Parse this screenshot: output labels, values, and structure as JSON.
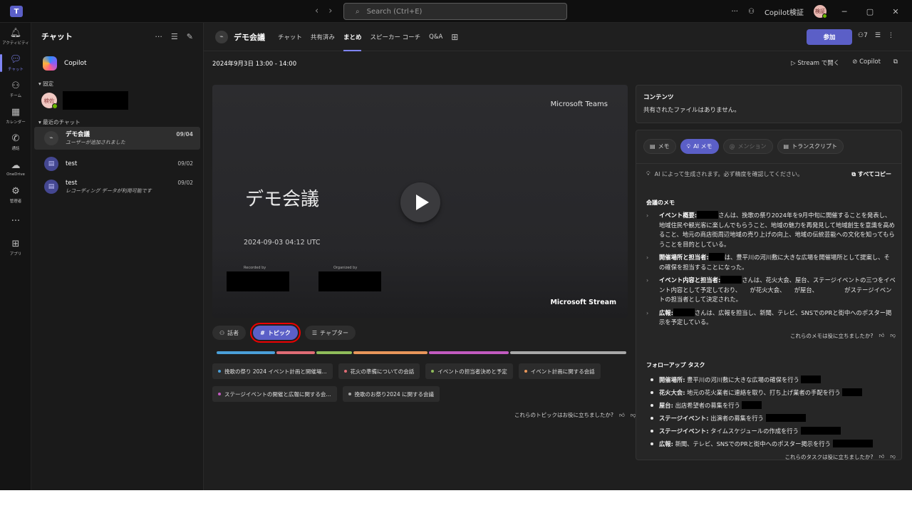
{
  "titlebar": {
    "search_placeholder": "Search (Ctrl+E)",
    "user_name": "Copilot検証",
    "user_initials": "検証"
  },
  "rail": [
    {
      "label": "アクティビティ",
      "icon": "bell-icon"
    },
    {
      "label": "チャット",
      "icon": "chat-icon"
    },
    {
      "label": "チーム",
      "icon": "teams-icon"
    },
    {
      "label": "カレンダー",
      "icon": "calendar-icon"
    },
    {
      "label": "通話",
      "icon": "phone-icon"
    },
    {
      "label": "OneDrive",
      "icon": "cloud-icon"
    },
    {
      "label": "管理者",
      "icon": "admin-icon"
    },
    {
      "label": "",
      "icon": "more-icon"
    },
    {
      "label": "アプリ",
      "icon": "apps-icon"
    }
  ],
  "chatlist": {
    "title": "チャット",
    "copilot": "Copilot",
    "pinned_label": "固定",
    "pinned_initials": "検佐",
    "recent_label": "最近のチャット",
    "chats": [
      {
        "name": "デモ会議",
        "sub": "ユーザーが追加されました",
        "date": "09/04"
      },
      {
        "name": "test",
        "sub": "",
        "date": "09/02"
      },
      {
        "name": "test",
        "sub": "レコーディング データが利用可能です",
        "date": "09/02"
      }
    ]
  },
  "meeting": {
    "title": "デモ会議",
    "tabs": [
      "チャット",
      "共有済み",
      "まとめ",
      "スピーカー コーチ",
      "Q&A"
    ],
    "active_tab": 2,
    "join_label": "参加",
    "participants": "7",
    "datetime": "2024年9月3日 13:00 - 14:00",
    "stream_open": "Stream で開く",
    "copilot": "Copilot"
  },
  "video": {
    "brand_top": "Microsoft Teams",
    "title": "デモ会議",
    "timestamp": "2024-09-03 04:12 UTC",
    "recorded_by": "Recorded by",
    "organized_by": "Organized by",
    "brand_bottom": "Microsoft Stream"
  },
  "segments": {
    "speakers": "話者",
    "topics": "トピック",
    "chapters": "チャプター"
  },
  "timeline_colors": [
    "#4a9fd8",
    "#e06c75",
    "#8fbc5a",
    "#e8965a",
    "#c25bc0",
    "#a8a8a8"
  ],
  "topics": [
    {
      "label": "挽歌の祭り 2024 イベント計画と開催場...",
      "color": "#4a9fd8"
    },
    {
      "label": "花火の準備についての会話",
      "color": "#e06c75"
    },
    {
      "label": "イベントの担当者決めと予定",
      "color": "#8fbc5a"
    },
    {
      "label": "イベント計画に関する会話",
      "color": "#e8965a"
    },
    {
      "label": "ステージイベントの開催と広報に関する会...",
      "color": "#c25bc0"
    },
    {
      "label": "挽歌のお祭り2024 に関する会議",
      "color": "#a8a8a8"
    }
  ],
  "topics_feedback": "これらのトピックはお役に立ちましたか?",
  "content": {
    "title": "コンテンツ",
    "body": "共有されたファイルはありません。"
  },
  "notes_tabs": [
    "メモ",
    "AI メモ",
    "メンション",
    "トランスクリプト"
  ],
  "ai_notice": "AI によって生成されます。必ず精度を確認してください。",
  "copy_all": "すべてコピー",
  "notes": {
    "heading": "会議のメモ",
    "items": [
      {
        "title": "イベント概要:",
        "text": "さんは、挽歌の祭り2024年を9月中旬に開催することを発表し、地域住民や観光客に楽しんでもらうこと、地域の魅力を再発見して地域創生を意識を高めること、地元の商店街周辺地域の売り上げの向上、地域の伝統芸能への文化を知ってもらうことを目的としている。"
      },
      {
        "title": "開催場所と担当者:",
        "text": "は、豊平川の河川敷に大きな広場を開催場所として提案し、その確保を担当することになった。"
      },
      {
        "title": "イベント内容と担当者:",
        "text": "さんは、花火大会、屋台、ステージイベントの三つをイベント内容として予定しており、　　が花火大会、　　が屋台、　　　　　がステージイベントの担当者として決定された。"
      },
      {
        "title": "広報:",
        "text": "さんは、広報を担当し、新聞、テレビ、SNSでのPRと街中へのポスター掲示を予定している。"
      }
    ],
    "feedback": "これらのメモは役に立ちましたか?"
  },
  "tasks": {
    "heading": "フォローアップ タスク",
    "items": [
      {
        "title": "開催場所:",
        "text": "豊平川の河川敷に大きな広場の確保を行う"
      },
      {
        "title": "花火大会:",
        "text": "地元の花火業者に連絡を取り、打ち上げ業者の手配を行う"
      },
      {
        "title": "屋台:",
        "text": "出店希望者の募集を行う"
      },
      {
        "title": "ステージイベント:",
        "text": "出演者の募集を行う"
      },
      {
        "title": "ステージイベント:",
        "text": "タイムスケジュールの作成を行う"
      },
      {
        "title": "広報:",
        "text": "新聞、テレビ、SNSでのPRと街中へのポスター掲示を行う"
      }
    ],
    "feedback": "これらのタスクは役に立ちましたか?"
  }
}
